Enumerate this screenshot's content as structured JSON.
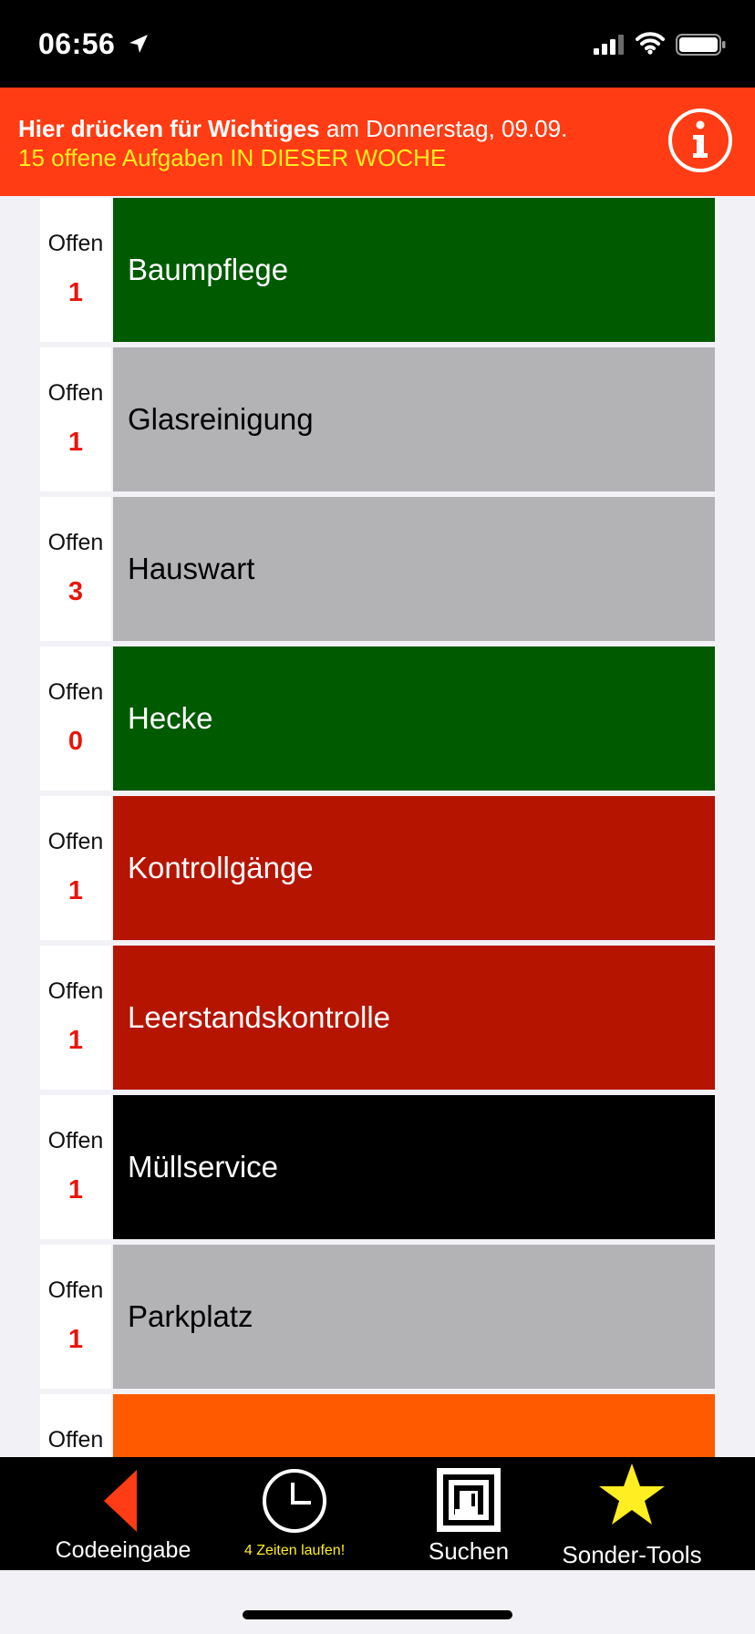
{
  "status_bar": {
    "time": "06:56",
    "icons": [
      "location-arrow-icon",
      "cellular-signal-icon",
      "wifi-icon",
      "battery-icon"
    ]
  },
  "banner": {
    "bold_text": "Hier drücken für Wichtiges",
    "date_text": " am Donnerstag, 09.09.",
    "tasks_text": "15 offene Aufgaben  IN DIESER WOCHE",
    "icon": "info-icon",
    "background_color": "#ff3c14",
    "highlight_color": "#ffee22"
  },
  "categories": [
    {
      "open_label": "Offen",
      "count": "1",
      "name": "Baumpflege",
      "color": "#005a00",
      "text_color": "#ffffff"
    },
    {
      "open_label": "Offen",
      "count": "1",
      "name": "Glasreinigung",
      "color": "#b3b2b4",
      "text_color": "#000000"
    },
    {
      "open_label": "Offen",
      "count": "3",
      "name": "Hauswart",
      "color": "#b3b2b4",
      "text_color": "#000000"
    },
    {
      "open_label": "Offen",
      "count": "0",
      "name": "Hecke",
      "color": "#005a00",
      "text_color": "#ffffff"
    },
    {
      "open_label": "Offen",
      "count": "1",
      "name": "Kontrollgänge",
      "color": "#b51500",
      "text_color": "#ffffff"
    },
    {
      "open_label": "Offen",
      "count": "1",
      "name": "Leerstandskontrolle",
      "color": "#b51500",
      "text_color": "#ffffff"
    },
    {
      "open_label": "Offen",
      "count": "1",
      "name": "Müllservice",
      "color": "#000000",
      "text_color": "#ffffff"
    },
    {
      "open_label": "Offen",
      "count": "1",
      "name": "Parkplatz",
      "color": "#b3b2b4",
      "text_color": "#000000"
    },
    {
      "open_label": "Offen",
      "count": "",
      "name": "",
      "color": "#ff5a00",
      "text_color": "#ffffff"
    }
  ],
  "tabbar": {
    "code_entry": {
      "label": "Codeeingabe",
      "icon": "back-triangle-icon"
    },
    "timers": {
      "label": "4 Zeiten laufen!",
      "icon": "clock-icon"
    },
    "search": {
      "label": "Suchen",
      "icon": "nfc-scan-icon"
    },
    "tools": {
      "label": "Sonder-Tools",
      "icon": "star-icon"
    }
  }
}
